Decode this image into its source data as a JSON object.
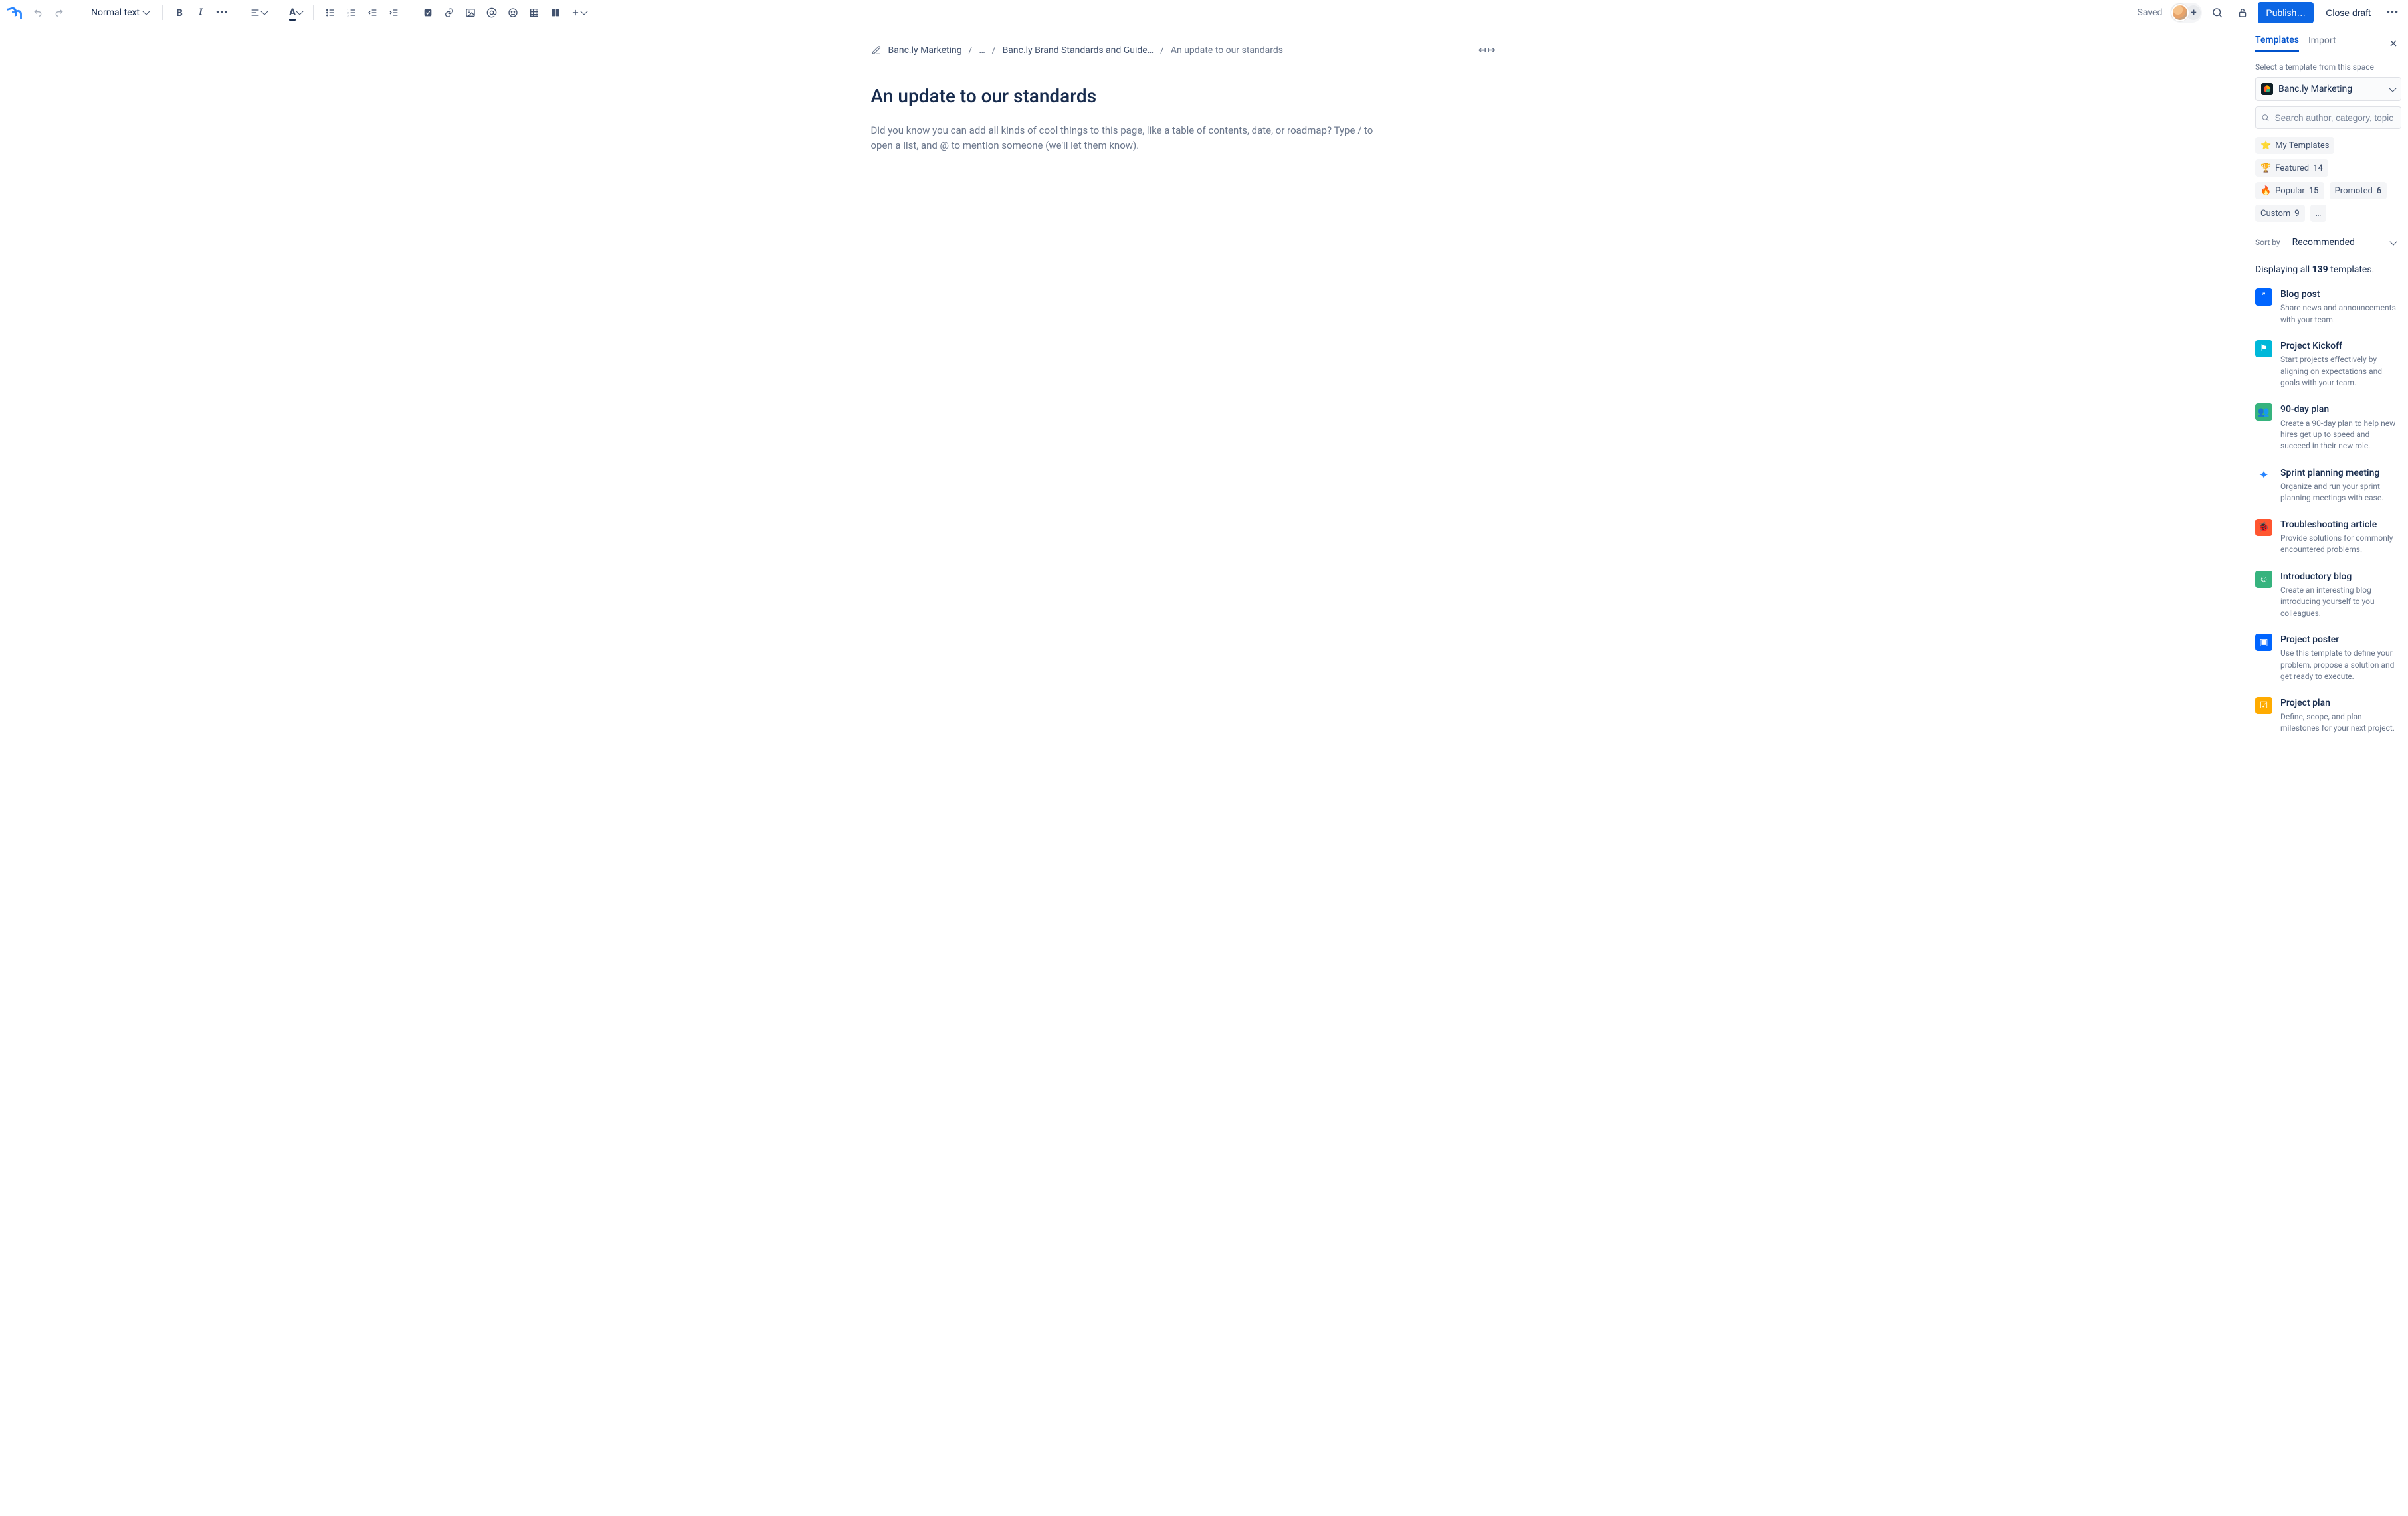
{
  "toolbar": {
    "text_style": "Normal text",
    "saved_label": "Saved",
    "publish_label": "Publish…",
    "close_draft_label": "Close draft"
  },
  "breadcrumb": {
    "items": [
      "Banc.ly Marketing",
      "…",
      "Banc.ly Brand Standards and Guide…",
      "An update to our standards"
    ]
  },
  "page": {
    "title": "An update to our standards",
    "placeholder": "Did you know you can add all kinds of cool things to this page, like a table of contents, date, or roadmap? Type / to open a list, and @ to mention someone (we'll let them know)."
  },
  "panel": {
    "tabs": {
      "templates": "Templates",
      "import": "Import"
    },
    "subhead": "Select a template from this space",
    "space_name": "Banc.ly Marketing",
    "search_placeholder": "Search author, category, topic",
    "chips": [
      {
        "emoji": "⭐",
        "label": "My Templates",
        "count": ""
      },
      {
        "emoji": "🏆",
        "label": "Featured",
        "count": "14"
      },
      {
        "emoji": "🔥",
        "label": "Popular",
        "count": "15"
      },
      {
        "emoji": "",
        "label": "Promoted",
        "count": "6"
      },
      {
        "emoji": "",
        "label": "Custom",
        "count": "9"
      },
      {
        "emoji": "",
        "label": "…",
        "count": ""
      }
    ],
    "sort": {
      "label": "Sort by",
      "value": "Recommended"
    },
    "displaying_prefix": "Displaying all ",
    "displaying_count": "139",
    "displaying_suffix": " templates.",
    "templates": [
      {
        "icon_bg": "#0065FF",
        "title": "Blog post",
        "desc": "Share news and announcements with your team."
      },
      {
        "icon_bg": "#00B8D9",
        "title": "Project Kickoff",
        "desc": "Start projects effectively by aligning on expectations and goals with your team."
      },
      {
        "icon_bg": "#36B37E",
        "title": "90-day plan",
        "desc": "Create a 90-day plan to help new hires get up to speed and succeed in their new role."
      },
      {
        "icon_bg": "#FFFFFF",
        "title": "Sprint planning meeting",
        "desc": "Organize and run your sprint planning meetings with ease."
      },
      {
        "icon_bg": "#FF5630",
        "title": "Troubleshooting article",
        "desc": "Provide solutions for commonly encountered problems."
      },
      {
        "icon_bg": "#36B37E",
        "title": "Introductory blog",
        "desc": "Create an interesting blog introducing yourself to you colleagues."
      },
      {
        "icon_bg": "#0065FF",
        "title": "Project poster",
        "desc": "Use this template to define your problem, propose a solution and get ready to execute."
      },
      {
        "icon_bg": "#FFAB00",
        "title": "Project plan",
        "desc": "Define, scope, and plan milestones for your next project."
      }
    ],
    "template_glyphs": [
      "”",
      "⚑",
      "👥",
      "✦",
      "🐞",
      "☺",
      "▣",
      "☑"
    ]
  }
}
